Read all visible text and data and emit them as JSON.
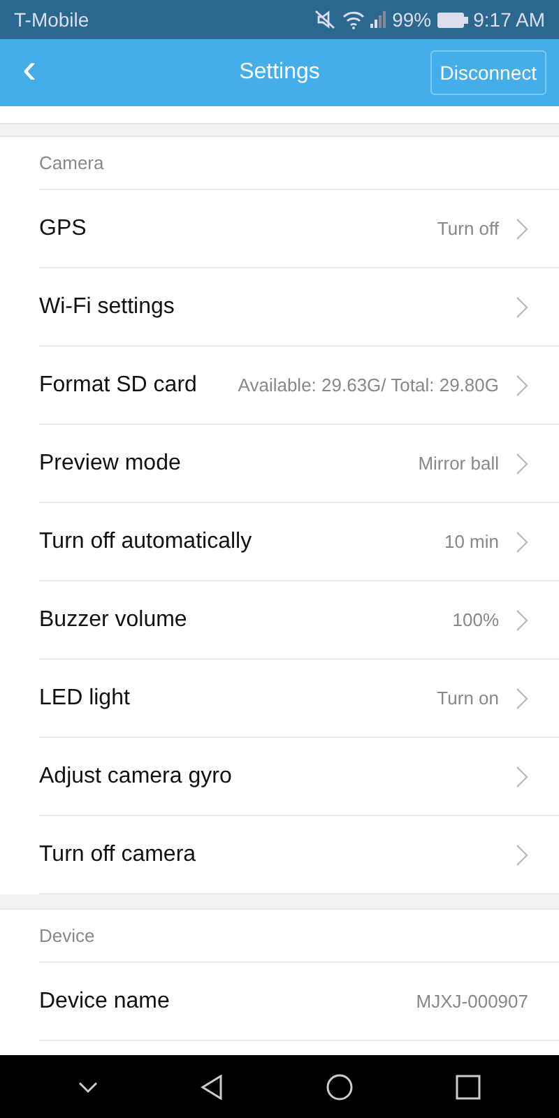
{
  "status_bar": {
    "carrier": "T-Mobile",
    "battery": "99%",
    "time": "9:17 AM"
  },
  "header": {
    "back": "‹",
    "title": "Settings",
    "action": "Disconnect"
  },
  "sections": [
    {
      "title": "Camera",
      "rows": [
        {
          "label": "GPS",
          "value": "Turn off",
          "chevron": true
        },
        {
          "label": "Wi-Fi settings",
          "chevron": true
        },
        {
          "label": "Format SD card",
          "value": "Available: 29.63G/ Total: 29.80G",
          "chevron": true
        },
        {
          "label": "Preview mode",
          "value": "Mirror ball",
          "chevron": true
        },
        {
          "label": "Turn off automatically",
          "value": "10 min",
          "chevron": true
        },
        {
          "label": "Buzzer volume",
          "value": "100%",
          "chevron": true
        },
        {
          "label": "LED light",
          "value": "Turn on",
          "chevron": true
        },
        {
          "label": "Adjust camera gyro",
          "chevron": true
        },
        {
          "label": "Turn off camera",
          "chevron": true
        }
      ]
    },
    {
      "title": "Device",
      "rows": [
        {
          "label": "Device name",
          "value": "MJXJ-000907",
          "chevron": false
        }
      ]
    }
  ]
}
